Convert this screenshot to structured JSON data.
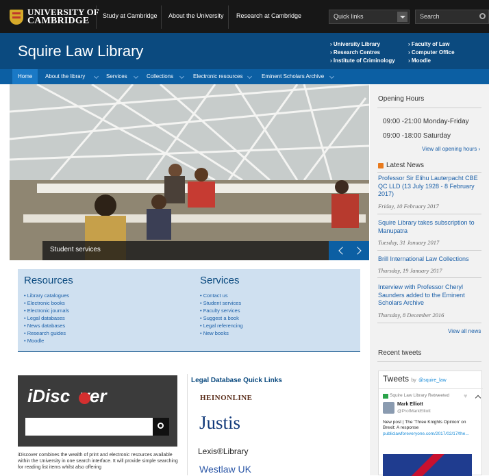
{
  "topbar": {
    "university_line1": "UNIVERSITY OF",
    "university_line2": "CAMBRIDGE",
    "nav": [
      "Study at Cambridge",
      "About the University",
      "Research at Cambridge"
    ],
    "quick_links": "Quick links",
    "search_placeholder": "Search"
  },
  "header": {
    "title": "Squire Law Library",
    "links_col1": [
      "University Library",
      "Research Centres",
      "Institute of Criminology"
    ],
    "links_col2": [
      "Faculty of Law",
      "Computer Office",
      "Moodle"
    ]
  },
  "nav": {
    "items": [
      "Home",
      "About the library",
      "Services",
      "Collections",
      "Electronic resources",
      "Eminent Scholars Archive"
    ]
  },
  "hero": {
    "caption": "Student services"
  },
  "sidebar": {
    "opening_hours_title": "Opening Hours",
    "hours": [
      "09:00 -21:00 Monday-Friday",
      "09:00 -18:00 Saturday"
    ],
    "view_all_hours": "View all opening hours ›",
    "latest_news_title": "Latest News",
    "news": [
      {
        "title": "Professor Sir Elihu Lauterpacht CBE QC LLD (13 July 1928 - 8 February 2017)",
        "date": "Friday, 10 February 2017"
      },
      {
        "title": "Squire Library takes subscription to Manupatra",
        "date": "Tuesday, 31 January 2017"
      },
      {
        "title": "Brill International Law Collections",
        "date": "Thursday, 19 January 2017"
      },
      {
        "title": "Interview with Professor Cheryl Saunders added to the Eminent Scholars Archive",
        "date": "Thursday, 8 December 2016"
      }
    ],
    "view_all_news": "View all news",
    "recent_tweets_title": "Recent tweets",
    "tweets_label": "Tweets",
    "tweets_by": "by",
    "tweets_handle": "@squire_law",
    "retweeted": "Squire Law Library Retweeted",
    "tweet_author": "Mark Elliott",
    "tweet_handle": "@ProfMarkElliott",
    "tweet_text": "New post | The 'Three Knights Opinion' on Brexit: A response",
    "tweet_link": "publiclawforeveryone.com/2017/02/17/the..."
  },
  "resources": {
    "title": "Resources",
    "items": [
      "Library catalogues",
      "Electronic books",
      "Electronic journals",
      "Legal databases",
      "News databases",
      "Research guides",
      "Moodle"
    ]
  },
  "services": {
    "title": "Services",
    "items": [
      "Contact us",
      "Student services",
      "Faculty services",
      "Suggest a book",
      "Legal referencing",
      "New books"
    ]
  },
  "idiscover": {
    "title_i": "i",
    "title_rest": "Disc  ver",
    "text": "iDiscover combines the wealth of print and electronic resources available within the University in one search interface. It will provide simple searching for reading list items whilst also offering"
  },
  "legal_db": {
    "title": "Legal Database Quick Links",
    "logos": [
      "HEINONLINE",
      "Justis",
      "Lexis®Library",
      "Westlaw UK"
    ]
  },
  "colors": {
    "header_blue": "#0b4a7f",
    "nav_blue": "#0c5fa3",
    "link_blue": "#1a5fa8",
    "panel_blue": "#cfe0f0"
  }
}
